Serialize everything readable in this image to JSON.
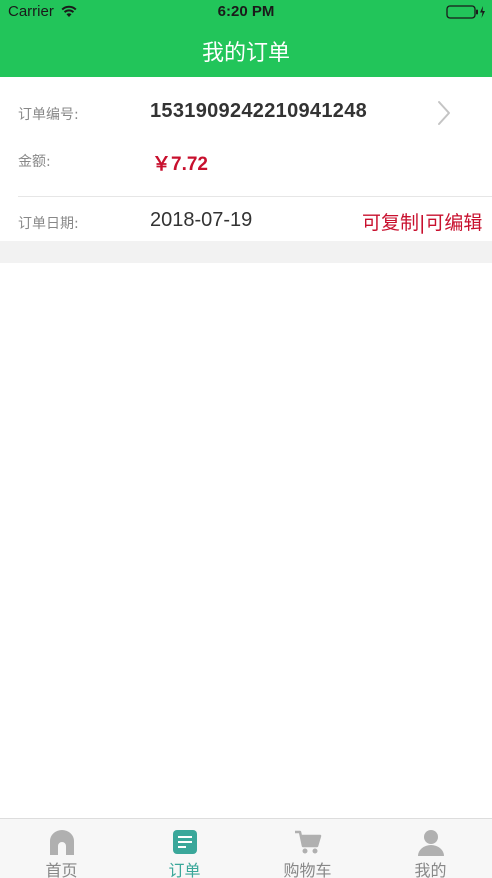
{
  "status_bar": {
    "carrier": "Carrier",
    "time": "6:20 PM"
  },
  "nav": {
    "title": "我的订单"
  },
  "order": {
    "order_no_label": "订单编号:",
    "order_no": "1531909242210941248",
    "amount_label": "金额:",
    "amount": "￥7.72",
    "date_label": "订单日期:",
    "date": "2018-07-19",
    "copy_edit_text": "可复制|可编辑"
  },
  "tabbar": {
    "tabs": [
      {
        "label": "首页",
        "icon": "home-icon",
        "active": false
      },
      {
        "label": "订单",
        "icon": "order-list-icon",
        "active": true
      },
      {
        "label": "购物车",
        "icon": "cart-icon",
        "active": false
      },
      {
        "label": "我的",
        "icon": "profile-icon",
        "active": false
      }
    ]
  },
  "colors": {
    "brand_green": "#22c55a",
    "accent_red": "#c8102e",
    "active_tab": "#3aa79a",
    "inactive_tab": "#b0b0b0"
  }
}
